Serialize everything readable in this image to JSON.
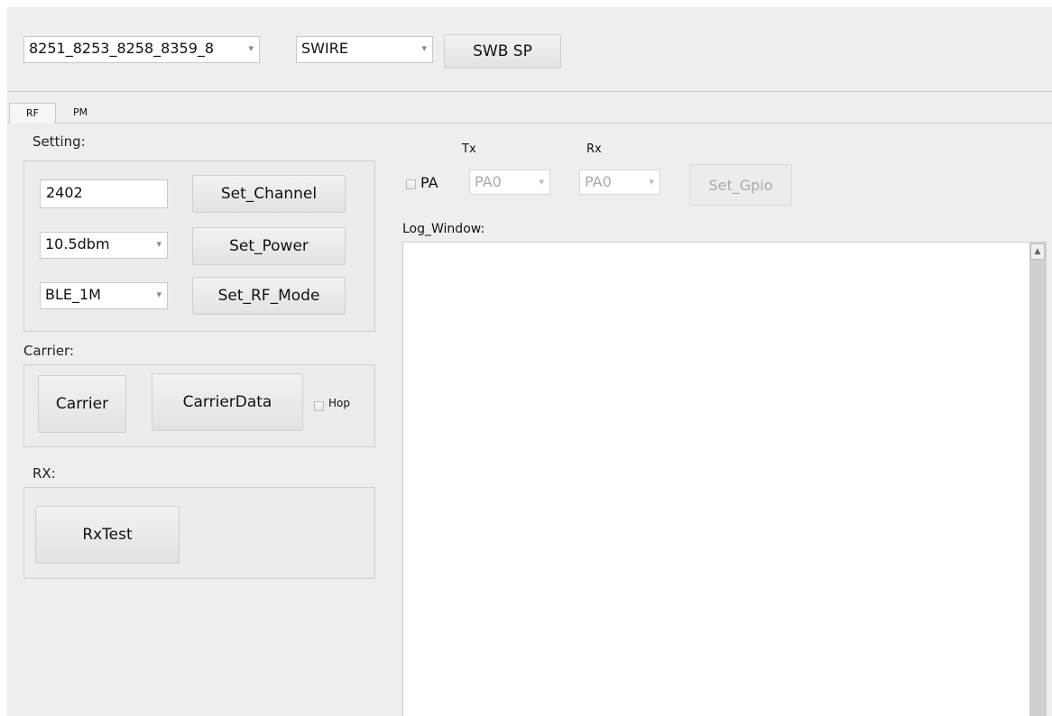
{
  "toolbar": {
    "chip_select": "8251_8253_8258_8359_8",
    "interface_select": "SWIRE",
    "swb_sp_label": "SWB SP"
  },
  "tabs": [
    {
      "label": "RF",
      "active": true
    },
    {
      "label": "PM",
      "active": false
    }
  ],
  "setting": {
    "section_label": "Setting:",
    "channel_value": "2402",
    "set_channel_label": "Set_Channel",
    "power_select": "10.5dbm",
    "set_power_label": "Set_Power",
    "rf_mode_select": "BLE_1M",
    "set_rf_mode_label": "Set_RF_Mode"
  },
  "carrier": {
    "section_label": "Carrier:",
    "carrier_label": "Carrier",
    "carrier_data_label": "CarrierData",
    "hop_label": "Hop",
    "hop_checked": false
  },
  "rx": {
    "section_label": "RX:",
    "rx_test_label": "RxTest"
  },
  "gpio": {
    "pa_label": "PA",
    "pa_checked": false,
    "tx_label": "Tx",
    "rx_label": "Rx",
    "tx_select": "PA0",
    "rx_select": "PA0",
    "set_gpio_label": "Set_Gpio"
  },
  "log": {
    "label": "Log_Window:",
    "content": ""
  },
  "icons": {
    "dropdown": "chevron-down-icon",
    "scroll_up": "scroll-up-arrow-icon"
  }
}
